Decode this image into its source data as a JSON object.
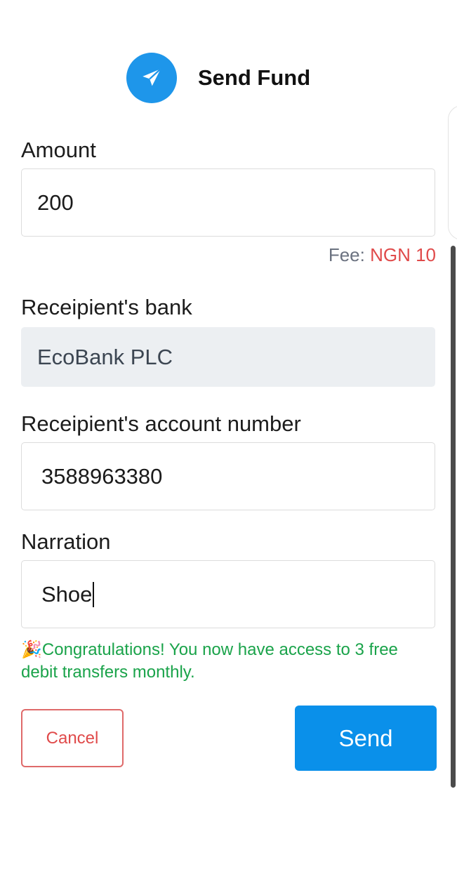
{
  "header": {
    "title": "Send Fund",
    "icon": "paper-plane-icon",
    "accent": "#1e96ea"
  },
  "amount": {
    "label": "Amount",
    "value": "200"
  },
  "fee": {
    "label": "Fee:",
    "value": "NGN 10"
  },
  "bank": {
    "label": "Receipient's bank",
    "value": "EcoBank PLC"
  },
  "account": {
    "label": "Receipient's account number",
    "value": "3588963380"
  },
  "narration": {
    "label": "Narration",
    "value": "Shoe"
  },
  "notice": {
    "emoji": "🎉",
    "text": "Congratulations! You now have access to 3 free debit transfers monthly."
  },
  "actions": {
    "cancel_label": "Cancel",
    "send_label": "Send"
  },
  "colors": {
    "send": "#0a90ea",
    "cancel": "#e04a4a",
    "notice": "#1aa34a",
    "fee_amount": "#e04a4a"
  }
}
